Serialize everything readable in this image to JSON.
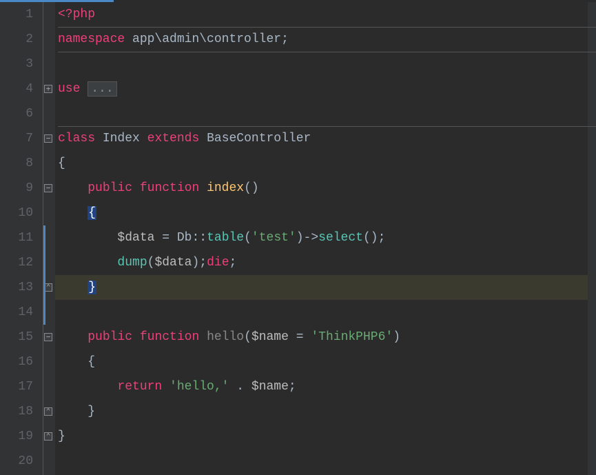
{
  "gutter": {
    "1": "1",
    "2": "2",
    "3": "3",
    "4": "4",
    "6": "6",
    "7": "7",
    "8": "8",
    "9": "9",
    "10": "10",
    "11": "11",
    "12": "12",
    "13": "13",
    "14": "14",
    "15": "15",
    "16": "16",
    "17": "17",
    "18": "18",
    "19": "19",
    "20": "20"
  },
  "fold": {
    "plus": "+",
    "minus": "−",
    "down": "⌄",
    "up": "⌃"
  },
  "code": {
    "l1": {
      "open": "<?php"
    },
    "l2": {
      "kw": "namespace",
      "ns": " app\\admin\\controller",
      "semi": ";"
    },
    "l4": {
      "kw": "use",
      "sp": " ",
      "folded": "..."
    },
    "l7": {
      "class": "class",
      "sp1": " ",
      "name": "Index",
      "sp2": " ",
      "ext": "extends",
      "sp3": " ",
      "base": "BaseController"
    },
    "l8": {
      "brace": "{"
    },
    "l9": {
      "indent": "    ",
      "pub": "public",
      "sp1": " ",
      "fn": "function",
      "sp2": " ",
      "name": "index",
      "paren": "()"
    },
    "l10": {
      "indent": "    ",
      "brace": "{"
    },
    "l11": {
      "indent": "        ",
      "var": "$data",
      "sp1": " ",
      "eq": "=",
      "sp2": " ",
      "db": "Db",
      "scope": "::",
      "m1": "table",
      "p1": "(",
      "str": "'test'",
      "p2": ")",
      "arrow": "->",
      "m2": "select",
      "p3": "()",
      "semi": ";"
    },
    "l12": {
      "indent": "        ",
      "fn": "dump",
      "p1": "(",
      "var": "$data",
      "p2": ")",
      "semi1": ";",
      "die": "die",
      "semi2": ";"
    },
    "l13": {
      "indent": "    ",
      "brace": "}"
    },
    "l15": {
      "indent": "    ",
      "pub": "public",
      "sp1": " ",
      "fn": "function",
      "sp2": " ",
      "name": "hello",
      "p1": "(",
      "var": "$name",
      "sp3": " ",
      "eq": "=",
      "sp4": " ",
      "str": "'ThinkPHP6'",
      "p2": ")"
    },
    "l16": {
      "indent": "    ",
      "brace": "{"
    },
    "l17": {
      "indent": "        ",
      "ret": "return",
      "sp1": " ",
      "str": "'hello,'",
      "sp2": " ",
      "dot": ".",
      "sp3": " ",
      "var": "$name",
      "semi": ";"
    },
    "l18": {
      "indent": "    ",
      "brace": "}"
    },
    "l19": {
      "brace": "}"
    }
  }
}
